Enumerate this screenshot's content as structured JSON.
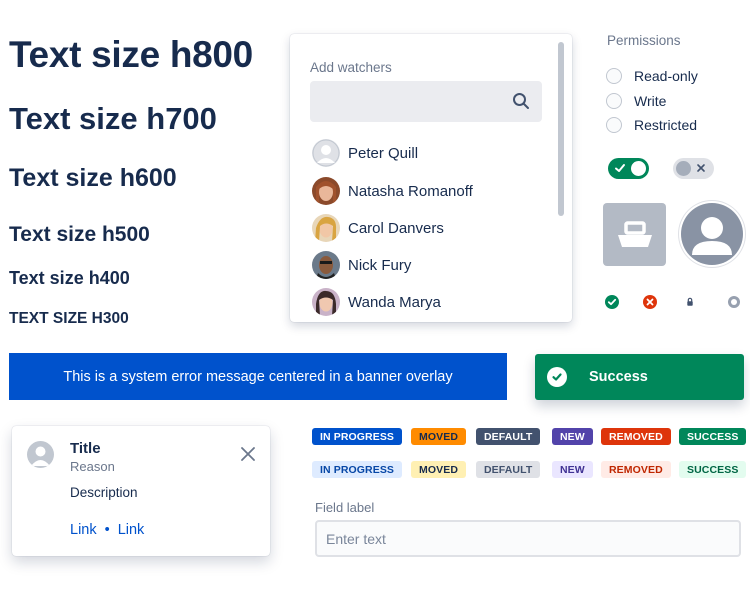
{
  "typography": {
    "h800": "Text size h800",
    "h700": "Text size h700",
    "h600": "Text size h600",
    "h500": "Text size h500",
    "h400": "Text size h400",
    "h300": "TEXT SIZE H300"
  },
  "watchers": {
    "label": "Add watchers",
    "search_icon": "search-icon",
    "people": [
      {
        "name": "Peter Quill",
        "avatar": "placeholder"
      },
      {
        "name": "Natasha Romanoff",
        "avatar": "photo"
      },
      {
        "name": "Carol Danvers",
        "avatar": "photo"
      },
      {
        "name": "Nick Fury",
        "avatar": "photo"
      },
      {
        "name": "Wanda Marya",
        "avatar": "photo"
      }
    ]
  },
  "permissions": {
    "title": "Permissions",
    "options": [
      "Read-only",
      "Write",
      "Restricted"
    ]
  },
  "toggles": {
    "on": true,
    "off": false
  },
  "status_icons": [
    "success-icon",
    "error-icon",
    "lock-icon",
    "circle-icon"
  ],
  "banner": {
    "text": "This is a system error message centered in a banner overlay",
    "color": "#0052CC"
  },
  "flag": {
    "text": "Success",
    "color": "#00875A"
  },
  "card": {
    "title": "Title",
    "reason": "Reason",
    "description": "Description",
    "links": [
      "Link",
      "Link"
    ],
    "separator": "•"
  },
  "lozenges": {
    "bold": [
      {
        "label": "IN PROGRESS",
        "bg": "#0052CC",
        "fg": "#FFFFFF"
      },
      {
        "label": "MOVED",
        "bg": "#FF8B00",
        "fg": "#172B4D"
      },
      {
        "label": "DEFAULT",
        "bg": "#42526E",
        "fg": "#FFFFFF"
      },
      {
        "label": "NEW",
        "bg": "#5243AA",
        "fg": "#FFFFFF"
      },
      {
        "label": "REMOVED",
        "bg": "#DE350B",
        "fg": "#FFFFFF"
      },
      {
        "label": "SUCCESS",
        "bg": "#00875A",
        "fg": "#FFFFFF"
      }
    ],
    "subtle": [
      {
        "label": "IN PROGRESS",
        "bg": "#DEEBFF",
        "fg": "#0747A6"
      },
      {
        "label": "MOVED",
        "bg": "#FFF0B3",
        "fg": "#172B4D"
      },
      {
        "label": "DEFAULT",
        "bg": "#DFE1E6",
        "fg": "#42526E"
      },
      {
        "label": "NEW",
        "bg": "#EAE6FF",
        "fg": "#403294"
      },
      {
        "label": "REMOVED",
        "bg": "#FFEBE6",
        "fg": "#BF2600"
      },
      {
        "label": "SUCCESS",
        "bg": "#E3FCEF",
        "fg": "#006644"
      }
    ]
  },
  "field": {
    "label": "Field label",
    "placeholder": "Enter text",
    "value": ""
  }
}
